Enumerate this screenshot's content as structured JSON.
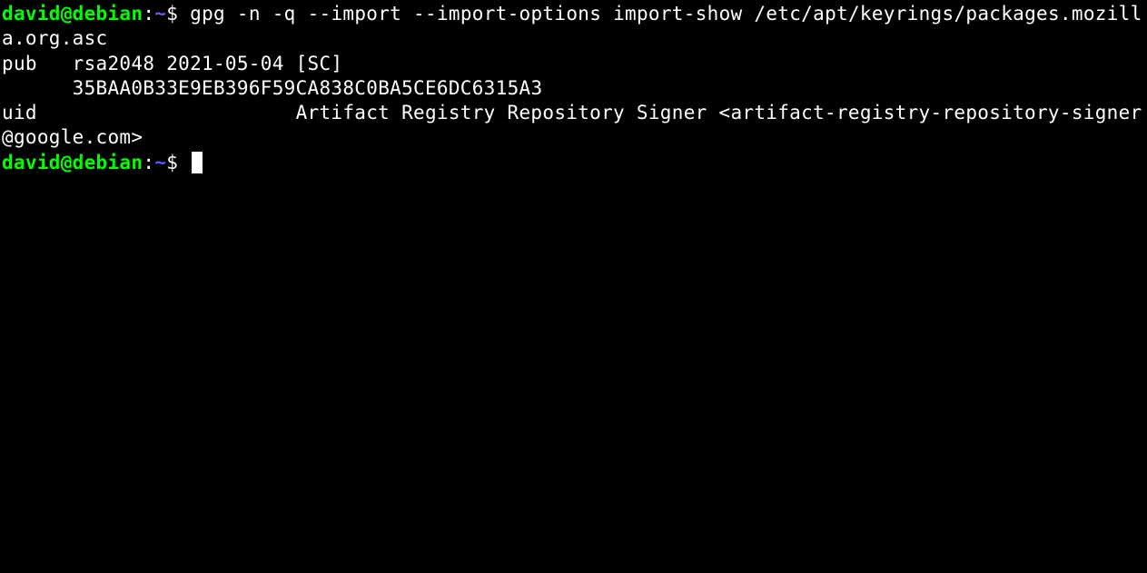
{
  "prompt": {
    "user_host": "david@debian",
    "separator": ":",
    "path": "~",
    "symbol": "$"
  },
  "command1": "gpg -n -q --import --import-options import-show /etc/apt/keyrings/packages.mozilla.org.asc",
  "output": {
    "line1": "pub   rsa2048 2021-05-04 [SC]",
    "line2": "      35BAA0B33E9EB396F59CA838C0BA5CE6DC6315A3",
    "line3": "uid                      Artifact Registry Repository Signer <artifact-registry-repository-signer@google.com>",
    "line4": ""
  }
}
